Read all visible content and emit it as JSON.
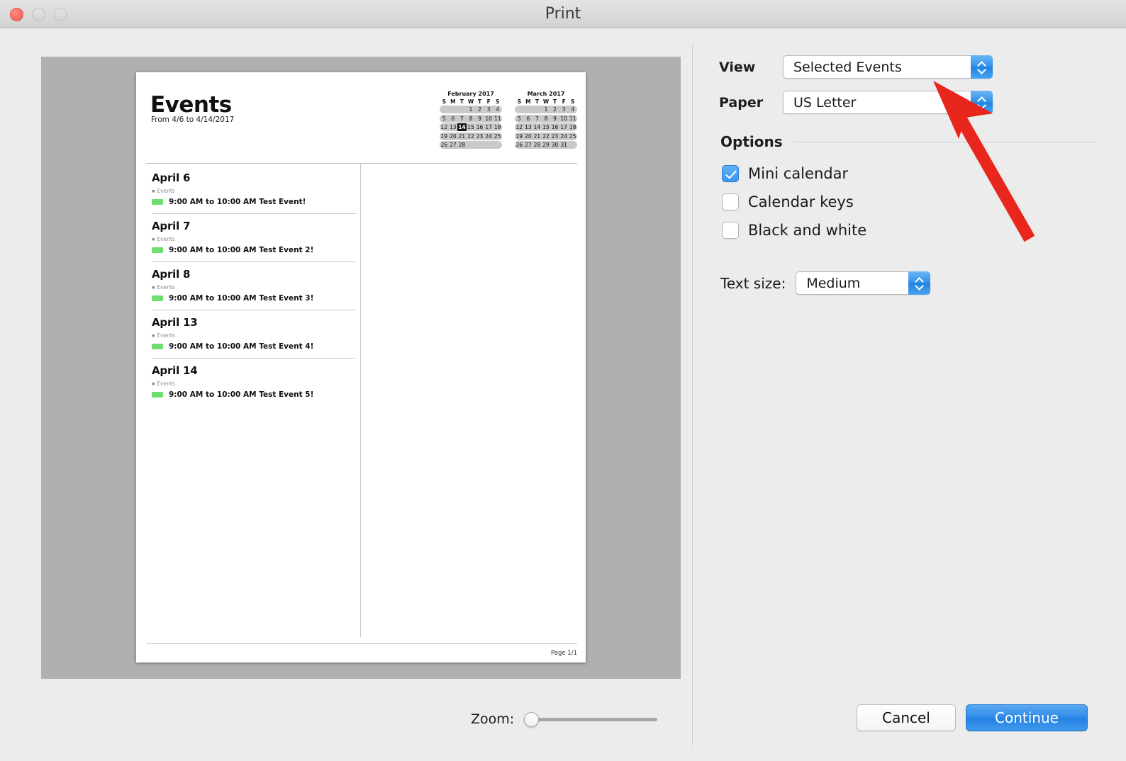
{
  "window": {
    "title": "Print",
    "traffic_lights": [
      "close",
      "minimize",
      "zoom"
    ]
  },
  "preview": {
    "document": {
      "title": "Events",
      "date_range": "From 4/6 to 4/14/2017",
      "page_number": "Page 1/1"
    },
    "mini_calendars": [
      {
        "title": "February 2017",
        "dow": [
          "S",
          "M",
          "T",
          "W",
          "T",
          "F",
          "S"
        ],
        "weeks": [
          [
            "",
            "",
            "",
            "1",
            "2",
            "3",
            "4"
          ],
          [
            "5",
            "6",
            "7",
            "8",
            "9",
            "10",
            "11"
          ],
          [
            "12",
            "13",
            "14",
            "15",
            "16",
            "17",
            "18"
          ],
          [
            "19",
            "20",
            "21",
            "22",
            "23",
            "24",
            "25"
          ],
          [
            "26",
            "27",
            "28",
            "",
            "",
            "",
            ""
          ]
        ],
        "highlighted_day": "14"
      },
      {
        "title": "March 2017",
        "dow": [
          "S",
          "M",
          "T",
          "W",
          "T",
          "F",
          "S"
        ],
        "weeks": [
          [
            "",
            "",
            "",
            "1",
            "2",
            "3",
            "4"
          ],
          [
            "5",
            "6",
            "7",
            "8",
            "9",
            "10",
            "11"
          ],
          [
            "12",
            "13",
            "14",
            "15",
            "16",
            "17",
            "18"
          ],
          [
            "19",
            "20",
            "21",
            "22",
            "23",
            "24",
            "25"
          ],
          [
            "26",
            "27",
            "28",
            "29",
            "30",
            "31",
            ""
          ]
        ],
        "highlighted_day": ""
      }
    ],
    "days": [
      {
        "day": "April 6",
        "calendar": "Events",
        "event_time": "9:00 AM to 10:00 AM",
        "event_title": "Test Event!",
        "event_color": "#6fdd6f"
      },
      {
        "day": "April 7",
        "calendar": "Events",
        "event_time": "9:00 AM to 10:00 AM",
        "event_title": "Test Event 2!",
        "event_color": "#6fdd6f"
      },
      {
        "day": "April 8",
        "calendar": "Events",
        "event_time": "9:00 AM to 10:00 AM",
        "event_title": "Test Event 3!",
        "event_color": "#6fdd6f"
      },
      {
        "day": "April 13",
        "calendar": "Events",
        "event_time": "9:00 AM to 10:00 AM",
        "event_title": "Test Event 4!",
        "event_color": "#6fdd6f"
      },
      {
        "day": "April 14",
        "calendar": "Events",
        "event_time": "9:00 AM to 10:00 AM",
        "event_title": "Test Event 5!",
        "event_color": "#6fdd6f"
      }
    ]
  },
  "settings": {
    "view": {
      "label": "View",
      "value": "Selected Events"
    },
    "paper": {
      "label": "Paper",
      "value": "US Letter"
    },
    "options": {
      "title": "Options",
      "items": [
        {
          "label": "Mini calendar",
          "checked": true
        },
        {
          "label": "Calendar keys",
          "checked": false
        },
        {
          "label": "Black and white",
          "checked": false
        }
      ]
    },
    "text_size": {
      "label": "Text size:",
      "value": "Medium"
    }
  },
  "footer": {
    "zoom_label": "Zoom:",
    "zoom_value": 0,
    "cancel_label": "Cancel",
    "continue_label": "Continue"
  },
  "annotation": {
    "arrow_color": "#e8261c"
  },
  "colors": {
    "accent_blue": "#3d95ee",
    "event_green": "#6fdd6f",
    "arrow_red": "#e8261c"
  }
}
